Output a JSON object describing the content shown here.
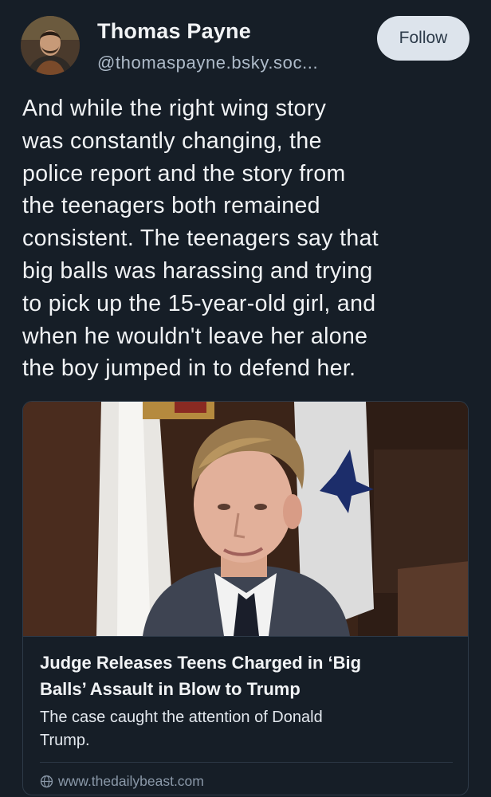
{
  "author": {
    "display_name": "Thomas Payne",
    "handle": "@thomaspayne.bsky.soc...",
    "follow_label": "Follow"
  },
  "post": {
    "text_lines": [
      "And while the right wing story",
      "was constantly changing, the",
      "police report and the story from",
      "the teenagers both remained",
      "consistent. The teenagers say that",
      "big balls was harassing and trying",
      "to pick up the 15-year-old girl, and",
      "when he wouldn't leave her alone",
      "the boy jumped in to defend her."
    ]
  },
  "link_card": {
    "title_lines": [
      "Judge Releases Teens Charged in ‘Big",
      "Balls’ Assault in Blow to Trump"
    ],
    "description_lines": [
      "The case caught the attention of Donald",
      "Trump."
    ],
    "domain": "www.thedailybeast.com",
    "image_icon": "news-photo",
    "domain_icon": "globe-icon"
  },
  "colors": {
    "background": "#161e27",
    "follow_button_bg": "#dde4ec",
    "follow_button_text": "#2c3a49",
    "handle_text": "#aebbc9",
    "card_border": "#2e3a48",
    "domain_text": "#8a98a8"
  }
}
